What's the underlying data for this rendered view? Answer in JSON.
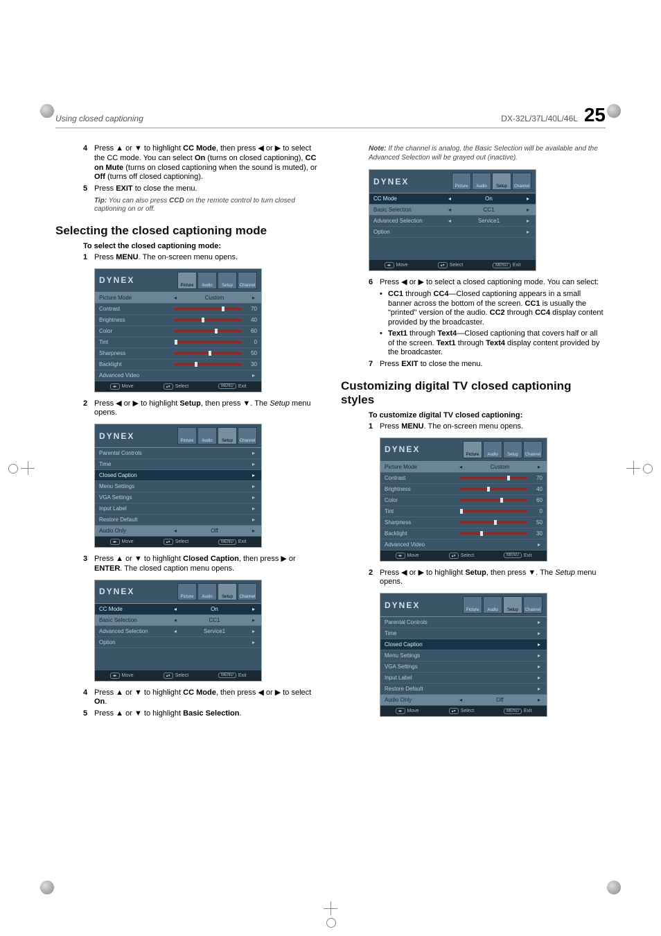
{
  "header": {
    "section": "Using closed captioning",
    "model": "DX-32L/37L/40L/46L",
    "page_number": "25"
  },
  "glyph": {
    "up": "▲",
    "down": "▼",
    "left": "◀",
    "right": "▶",
    "chev_l": "◂",
    "chev_r": "▸"
  },
  "left": {
    "step4": "Press ▲ or ▼ to highlight ",
    "step4_b1": "CC Mode",
    "step4_mid": ", then press ◀ or ▶ to select the CC mode. You can select ",
    "step4_b2": "On",
    "step4_mid2": " (turns on closed captioning), ",
    "step4_b3": "CC on Mute",
    "step4_mid3": " (turns on closed captioning when the sound is muted), or ",
    "step4_b4": "Off",
    "step4_end": " (turns off closed captioning).",
    "step5": "Press ",
    "step5_b": "EXIT",
    "step5_end": " to close the menu.",
    "tip_b": "Tip:",
    "tip": " You can also press ",
    "tip_b2": "CCD",
    "tip_end": " on the remote control to turn closed captioning on or off.",
    "h2": "Selecting the closed captioning mode",
    "h3": "To select the closed captioning mode:",
    "s1": "Press ",
    "s1_b": "MENU",
    "s1_end": ". The on-screen menu opens.",
    "s2a": "Press ◀ or ▶ to highlight ",
    "s2_b": "Setup",
    "s2b": ", then press ▼. The ",
    "s2_i": "Setup",
    "s2c": " menu opens.",
    "s3a": "Press ▲ or ▼ to highlight ",
    "s3_b": "Closed Caption",
    "s3b": ", then press ▶ or ",
    "s3_b2": "ENTER",
    "s3c": ". The closed caption menu opens.",
    "s4a": "Press ▲ or ▼ to highlight ",
    "s4_b": "CC Mode",
    "s4b": ", then press ◀ or ▶ to select ",
    "s4_b2": "On",
    "s4c": ".",
    "s5a": "Press ▲ or ▼ to highlight ",
    "s5_b": "Basic Selection",
    "s5b": "."
  },
  "right": {
    "note_b": "Note:",
    "note": " If the channel is analog, the Basic Selection will be available and the Advanced Selection will be grayed out (inactive).",
    "s6": "Press ◀ or ▶ to select a closed captioning mode. You can select:",
    "b1a": "CC1",
    "b1b": "CC4",
    "b1txt": "—Closed captioning appears in a small banner across the bottom of the screen. ",
    "b1c": "CC1",
    "b1d": " is usually the \"printed\" version of the audio. ",
    "b1e": "CC2",
    "b1f": " through ",
    "b1g": "CC4",
    "b1end": " display content provided by the broadcaster.",
    "b2a": "Text1",
    "b2b": "Text4",
    "b2txt": "—Closed captioning that covers half or all of the screen. ",
    "b2c": "Text1",
    "b2d": " through ",
    "b2e": "Text4",
    "b2end": " display content provided by the broadcaster.",
    "s7": "Press ",
    "s7_b": "EXIT",
    "s7_end": " to close the menu.",
    "h2": "Customizing digital TV closed captioning styles",
    "h3": "To customize digital TV closed captioning:",
    "r1": "Press ",
    "r1_b": "MENU",
    "r1_end": ". The on-screen menu opens.",
    "r2a": "Press ◀ or ▶ to highlight ",
    "r2_b": "Setup",
    "r2b": ", then press ▼. The ",
    "r2_i": "Setup",
    "r2c": " menu opens."
  },
  "osd": {
    "logo": "DYNEX",
    "tabs": [
      "Picture",
      "Audio",
      "Setup",
      "Channel"
    ],
    "foot_move": "Move",
    "foot_select": "Select",
    "foot_exit": "Exit",
    "foot_menu": "MENU",
    "picture": {
      "rows": [
        {
          "label": "Picture Mode",
          "val": "Custom",
          "hl": true,
          "type": "pick"
        },
        {
          "label": "Contrast",
          "val": 70,
          "type": "slider"
        },
        {
          "label": "Brightness",
          "val": 40,
          "type": "slider"
        },
        {
          "label": "Color",
          "val": 60,
          "type": "slider"
        },
        {
          "label": "Tint",
          "val": 0,
          "type": "slider"
        },
        {
          "label": "Sharpness",
          "val": 50,
          "type": "slider"
        },
        {
          "label": "Backlight",
          "val": 30,
          "type": "slider"
        },
        {
          "label": "Advanced Video",
          "type": "sub"
        }
      ]
    },
    "setup": {
      "rows": [
        {
          "label": "Parental Controls",
          "type": "sub"
        },
        {
          "label": "Time",
          "type": "sub"
        },
        {
          "label": "Closed   Caption",
          "type": "sub",
          "hl2": true
        },
        {
          "label": "Menu Settings",
          "type": "sub"
        },
        {
          "label": "VGA  Settings",
          "type": "sub"
        },
        {
          "label": "Input Label",
          "type": "sub"
        },
        {
          "label": "Restore Default",
          "type": "sub"
        },
        {
          "label": "Audio Only",
          "val": "Off",
          "type": "pick",
          "hl": true
        }
      ]
    },
    "cc": {
      "rows": [
        {
          "label": "CC Mode",
          "val": "On",
          "type": "pick",
          "hl2": true
        },
        {
          "label": "Basic Selection",
          "val": "CC1",
          "type": "pick",
          "hl": true
        },
        {
          "label": "Advanced Selection",
          "val": "Service1",
          "type": "pick"
        },
        {
          "label": "Option",
          "type": "sub"
        }
      ]
    }
  }
}
